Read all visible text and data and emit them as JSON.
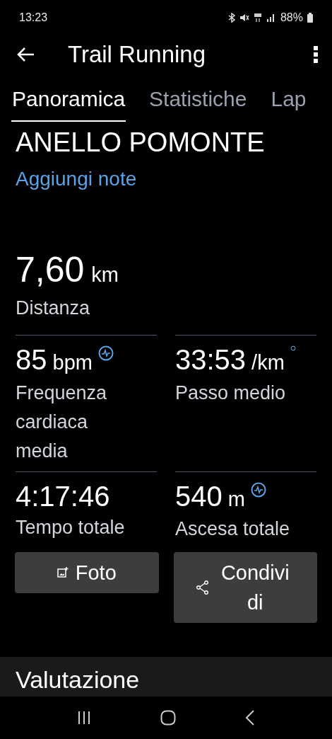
{
  "status_bar": {
    "time": "13:23",
    "battery": "88%"
  },
  "toolbar": {
    "title": "Trail Running"
  },
  "tabs": [
    {
      "label": "Panoramica",
      "selected": true
    },
    {
      "label": "Statistiche",
      "selected": false
    },
    {
      "label": "Lap",
      "selected": false
    }
  ],
  "activity": {
    "name": "ANELLO POMONTE",
    "add_note": "Aggiungi note"
  },
  "distance": {
    "value": "7,60",
    "unit": "km",
    "label": "Distanza"
  },
  "stats": [
    {
      "value": "85",
      "unit": "bpm",
      "label": "Frequenza cardiaca media",
      "kind": "wave"
    },
    {
      "value": "33:53",
      "unit": "/km",
      "label": "Passo medio",
      "kind": "dot"
    },
    {
      "value": "4:17:46",
      "label": "Tempo totale",
      "kind": "plain"
    },
    {
      "value": "540",
      "unit": "m",
      "label": "Ascesa totale",
      "kind": "wave"
    }
  ],
  "buttons": [
    {
      "kind": "photo",
      "label": "Foto"
    },
    {
      "kind": "share",
      "label": "Condividi"
    }
  ],
  "section": {
    "title": "Valutazione"
  }
}
